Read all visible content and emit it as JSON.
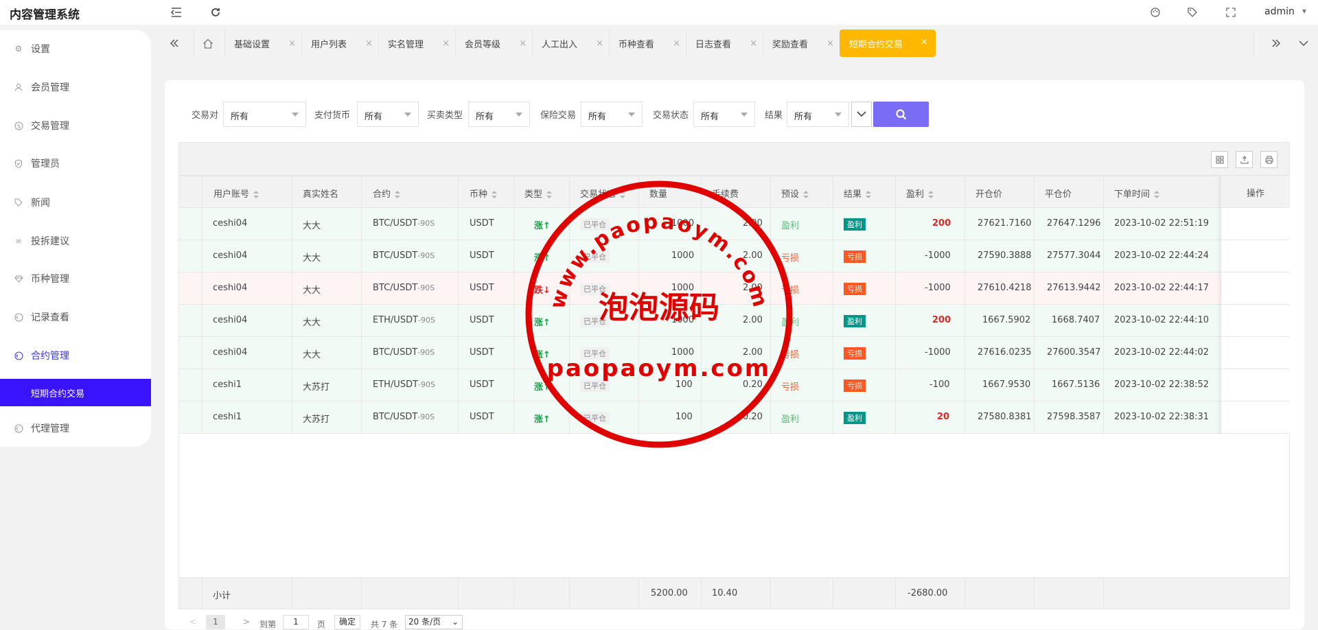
{
  "header": {
    "app_title": "内容管理系统",
    "user": "admin"
  },
  "sidebar": {
    "items": [
      {
        "label": "设置",
        "icon": "gear-icon"
      },
      {
        "label": "会员管理",
        "icon": "user-icon"
      },
      {
        "label": "交易管理",
        "icon": "dollar-icon"
      },
      {
        "label": "管理员",
        "icon": "shield-icon"
      },
      {
        "label": "新闻",
        "icon": "tag-icon"
      },
      {
        "label": "投拆建议",
        "icon": "link-icon"
      },
      {
        "label": "币种管理",
        "icon": "diamond-icon"
      },
      {
        "label": "记录查看",
        "icon": "record-icon"
      },
      {
        "label": "合约管理",
        "icon": "contract-icon"
      },
      {
        "label": "代理管理",
        "icon": "agent-icon"
      }
    ],
    "active_sub": "短期合约交易"
  },
  "tabs": [
    "基础设置",
    "用户列表",
    "实名管理",
    "会员等级",
    "人工出入",
    "币种查看",
    "日志查看",
    "奖励查看"
  ],
  "active_tab": "短期合约交易",
  "filters": [
    {
      "label": "交易对",
      "value": "所有"
    },
    {
      "label": "支付货币",
      "value": "所有"
    },
    {
      "label": "买卖类型",
      "value": "所有"
    },
    {
      "label": "保险交易",
      "value": "所有"
    },
    {
      "label": "交易状态",
      "value": "所有"
    },
    {
      "label": "结果",
      "value": "所有"
    }
  ],
  "table": {
    "headers": [
      "用户账号",
      "真实姓名",
      "合约",
      "币种",
      "类型",
      "交易状态",
      "数量",
      "手续费",
      "预设",
      "结果",
      "盈利",
      "开仓价",
      "平仓价",
      "下单时间",
      "操作"
    ],
    "rows": [
      {
        "account": "ceshi04",
        "name": "大大",
        "contract": "BTC/USDT",
        "period": "-90S",
        "coin": "USDT",
        "type": "涨↑",
        "status": "已平仓",
        "qty": "1000",
        "fee": "2.00",
        "preset": "盈利",
        "result": "盈利",
        "profit": "200",
        "open": "27621.7160",
        "close": "27647.1296",
        "time": "2023-10-02 22:51:19"
      },
      {
        "account": "ceshi04",
        "name": "大大",
        "contract": "BTC/USDT",
        "period": "-90S",
        "coin": "USDT",
        "type": "涨↑",
        "status": "已平仓",
        "qty": "1000",
        "fee": "2.00",
        "preset": "亏损",
        "result": "亏损",
        "profit": "-1000",
        "open": "27590.3888",
        "close": "27577.3044",
        "time": "2023-10-02 22:44:24"
      },
      {
        "account": "ceshi04",
        "name": "大大",
        "contract": "BTC/USDT",
        "period": "-90S",
        "coin": "USDT",
        "type": "跌↓",
        "status": "已平仓",
        "qty": "1000",
        "fee": "2.00",
        "preset": "亏损",
        "result": "亏损",
        "profit": "-1000",
        "open": "27610.4218",
        "close": "27613.9442",
        "time": "2023-10-02 22:44:17"
      },
      {
        "account": "ceshi04",
        "name": "大大",
        "contract": "ETH/USDT",
        "period": "-90S",
        "coin": "USDT",
        "type": "涨↑",
        "status": "已平仓",
        "qty": "1000",
        "fee": "2.00",
        "preset": "盈利",
        "result": "盈利",
        "profit": "200",
        "open": "1667.5902",
        "close": "1668.7407",
        "time": "2023-10-02 22:44:10"
      },
      {
        "account": "ceshi04",
        "name": "大大",
        "contract": "BTC/USDT",
        "period": "-90S",
        "coin": "USDT",
        "type": "涨↑",
        "status": "已平仓",
        "qty": "1000",
        "fee": "2.00",
        "preset": "亏损",
        "result": "亏损",
        "profit": "-1000",
        "open": "27616.0235",
        "close": "27600.3547",
        "time": "2023-10-02 22:44:02"
      },
      {
        "account": "ceshi1",
        "name": "大苏打",
        "contract": "ETH/USDT",
        "period": "-90S",
        "coin": "USDT",
        "type": "涨↑",
        "status": "已平仓",
        "qty": "100",
        "fee": "0.20",
        "preset": "亏损",
        "result": "亏损",
        "profit": "-100",
        "open": "1667.9530",
        "close": "1667.5136",
        "time": "2023-10-02 22:38:52"
      },
      {
        "account": "ceshi1",
        "name": "大苏打",
        "contract": "BTC/USDT",
        "period": "-90S",
        "coin": "USDT",
        "type": "涨↑",
        "status": "已平仓",
        "qty": "100",
        "fee": "0.20",
        "preset": "盈利",
        "result": "盈利",
        "profit": "20",
        "open": "27580.8381",
        "close": "27598.3587",
        "time": "2023-10-02 22:38:31"
      }
    ],
    "footer": {
      "label": "小计",
      "qty": "5200.00",
      "fee": "10.40",
      "profit": "-2680.00"
    }
  },
  "pager": {
    "goto_label": "到第",
    "page": "1",
    "page_unit": "页",
    "confirm": "确定",
    "total": "共 7 条",
    "per_page": "20 条/页"
  },
  "watermark": {
    "top_text": "www.paopaoym.com",
    "center_text": "泡泡源码",
    "bottom_text": "paopaoym.com"
  },
  "colors": {
    "accent": "#3b14ff",
    "tab_active": "#ffb800",
    "search_button": "#7b6cf6",
    "win": "#009688",
    "loss": "#ff5722",
    "stamp": "#e00000"
  }
}
